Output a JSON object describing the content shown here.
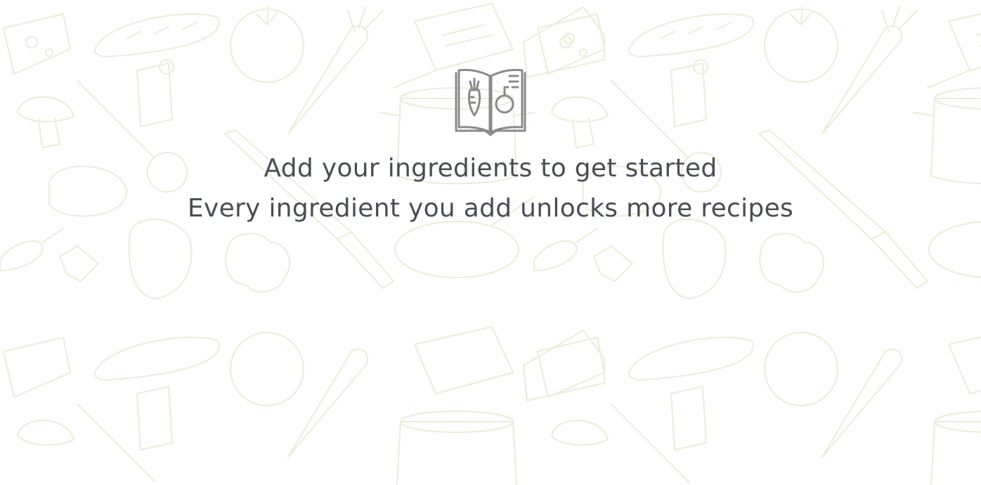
{
  "colors": {
    "background": "#ffffff",
    "pattern_stroke": "#e6efd6",
    "text": "#4a4d52",
    "icon": "#8a8a8a"
  },
  "icons": {
    "empty_state": "recipe-book-icon",
    "background_pattern": "food-doodle-pattern"
  },
  "empty_state": {
    "title": "Add your ingredients to get started",
    "subtitle": "Every ingredient you add unlocks more recipes"
  }
}
